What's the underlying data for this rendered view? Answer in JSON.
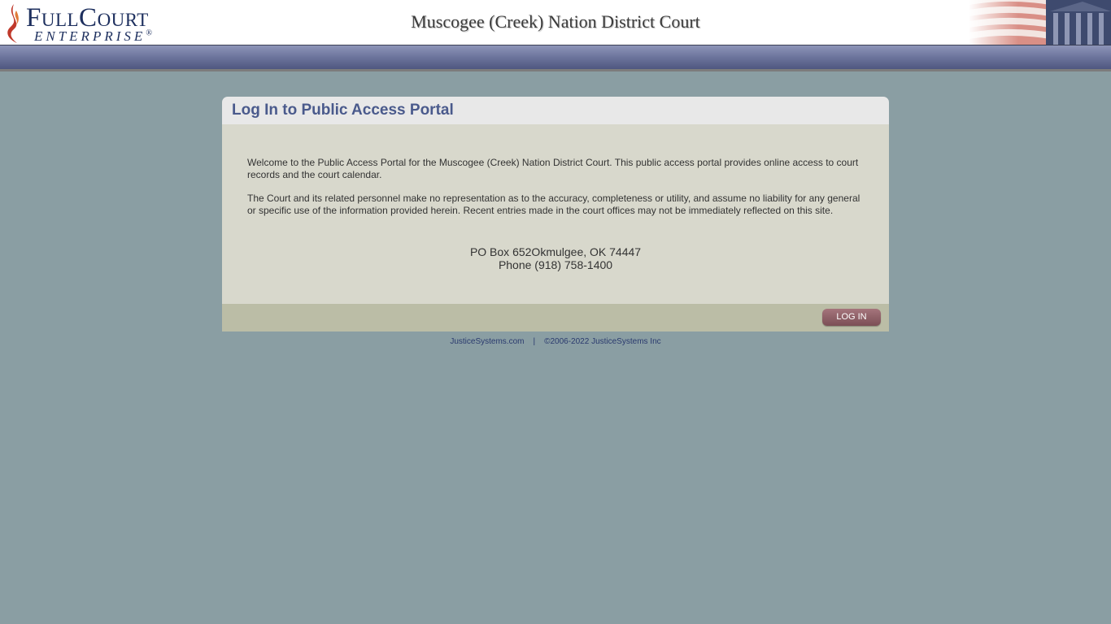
{
  "header": {
    "logo_main": "FullCourt",
    "logo_sub": "ENTERPRISE",
    "logo_mark": "®",
    "court_name": "Muscogee (Creek) Nation District Court"
  },
  "panel": {
    "title": "Log In to Public Access Portal",
    "welcome_text": "Welcome to the Public Access Portal for the Muscogee (Creek) Nation District Court. This public access portal provides online access to court records and the court calendar.",
    "disclaimer_text": "The Court and its related personnel make no representation as to the accuracy, completeness or utility, and assume no liability for any general or specific use of the information provided herein. Recent entries made in the court offices may not be immediately reflected on this site.",
    "address_line": "PO Box 652Okmulgee, OK 74447",
    "phone_line": "Phone (918) 758-1400",
    "login_label": "LOG IN"
  },
  "footer": {
    "link_label": "JusticeSystems.com",
    "separator": "|",
    "copyright": "©2006-2022 JusticeSystems Inc"
  },
  "colors": {
    "page_bg": "#8a9ea3",
    "title": "#4a5a8c",
    "navbar": "#6c749c",
    "login_button": "#8f5f66"
  },
  "icons": {
    "logo": "flame-icon",
    "header_art": "flag-courthouse-art"
  }
}
